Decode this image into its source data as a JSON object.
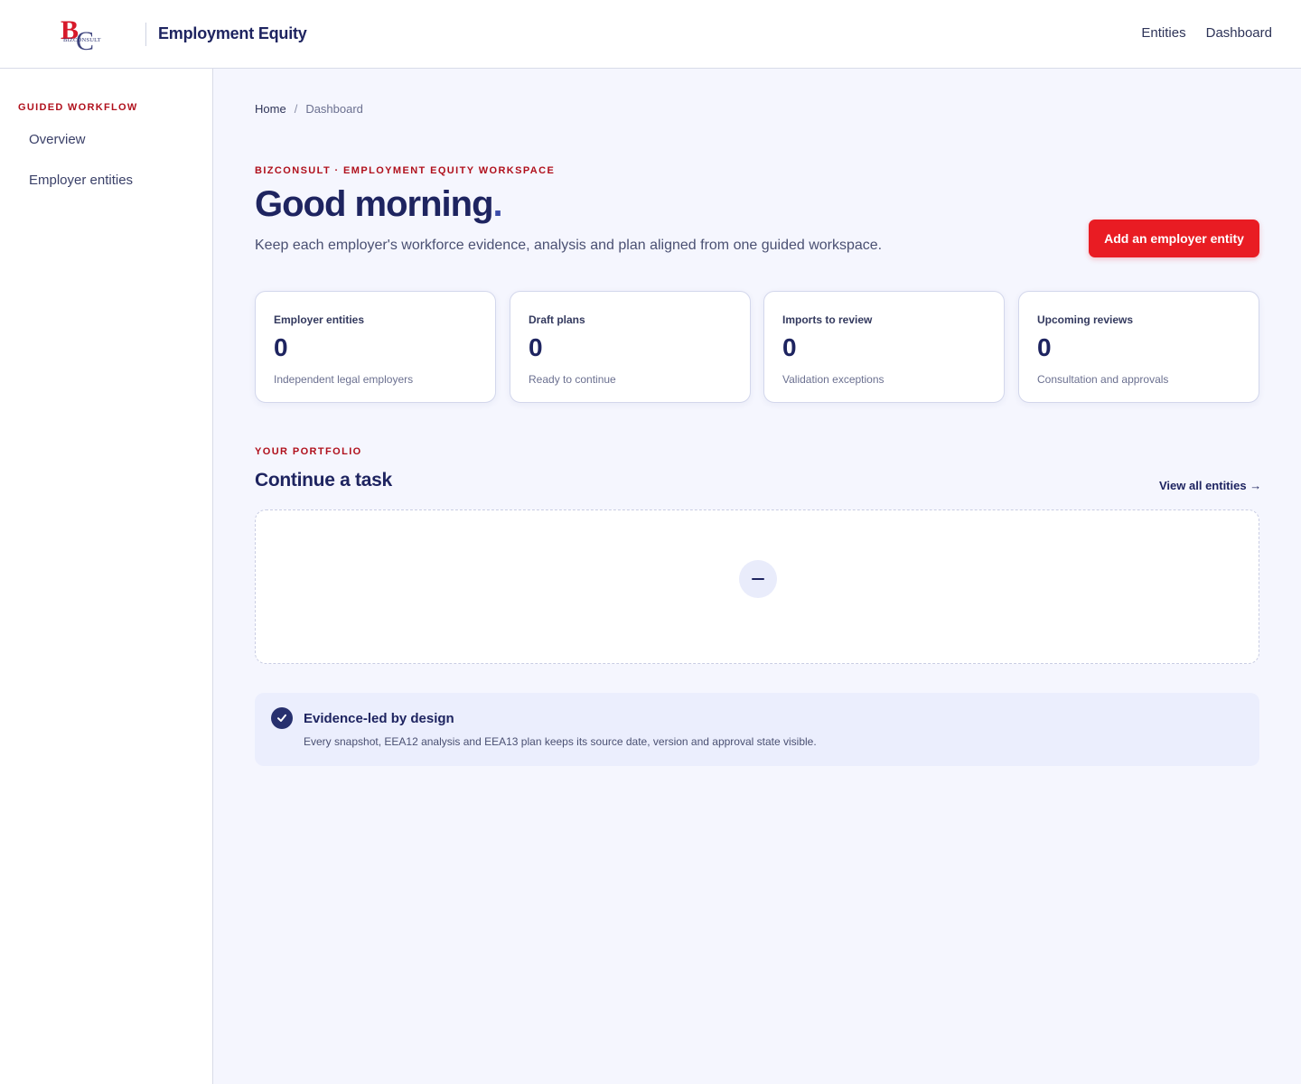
{
  "header": {
    "logo_letters": "BC",
    "logo_wordmark": "BIZCONSULT",
    "app_title": "Employment Equity",
    "nav": [
      {
        "label": "Entities"
      },
      {
        "label": "Dashboard"
      }
    ]
  },
  "sidebar": {
    "heading": "GUIDED WORKFLOW",
    "items": [
      {
        "label": "Overview"
      },
      {
        "label": "Employer entities"
      }
    ]
  },
  "breadcrumb": {
    "home": "Home",
    "separator": "/",
    "current": "Dashboard"
  },
  "hero": {
    "eyebrow": "BIZCONSULT · EMPLOYMENT EQUITY WORKSPACE",
    "greeting": "Good morning",
    "greeting_dot": ".",
    "subtitle": "Keep each employer's workforce evidence, analysis and plan aligned from one guided workspace.",
    "primary_button": "Add an employer entity"
  },
  "stats": [
    {
      "label": "Employer entities",
      "value": "0",
      "sub": "Independent legal employers"
    },
    {
      "label": "Draft plans",
      "value": "0",
      "sub": "Ready to continue"
    },
    {
      "label": "Imports to review",
      "value": "0",
      "sub": "Validation exceptions"
    },
    {
      "label": "Upcoming reviews",
      "value": "0",
      "sub": "Consultation and approvals"
    }
  ],
  "portfolio": {
    "eyebrow": "YOUR PORTFOLIO",
    "title": "Continue a task",
    "view_all": "View all entities →",
    "empty_icon": "minus-icon"
  },
  "info": {
    "icon": "check-icon",
    "title": "Evidence-led by design",
    "text": "Every snapshot, EEA12 analysis and EEA13 plan keeps its source date, version and approval state visible."
  },
  "colors": {
    "accent_red": "#e91c23",
    "eyebrow_red": "#b0101c",
    "navy": "#1e2460",
    "page_bg": "#f5f6fe",
    "info_bg": "#ebeefd"
  }
}
